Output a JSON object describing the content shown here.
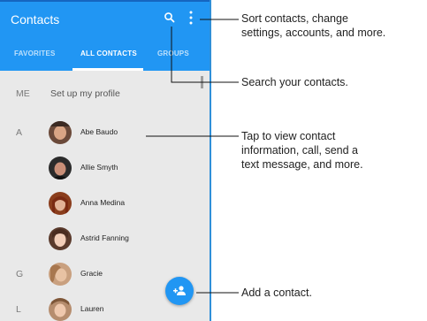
{
  "app": {
    "title": "Contacts",
    "search_icon": "search-icon",
    "more_icon": "more-vert-icon",
    "accent_color": "#2196f3"
  },
  "tabs": [
    {
      "label": "FAVORITES",
      "active": false
    },
    {
      "label": "ALL CONTACTS",
      "active": true
    },
    {
      "label": "GROUPS",
      "active": false
    }
  ],
  "profile": {
    "letter": "ME",
    "text": "Set up my profile"
  },
  "contacts": [
    {
      "letter": "A",
      "name": "Abe Baudo"
    },
    {
      "letter": "",
      "name": "Allie Smyth"
    },
    {
      "letter": "",
      "name": "Anna Medina"
    },
    {
      "letter": "",
      "name": "Astrid Fanning"
    },
    {
      "letter": "G",
      "name": "Gracie"
    },
    {
      "letter": "L",
      "name": "Lauren"
    }
  ],
  "fab": {
    "icon": "add-person-icon"
  },
  "callouts": {
    "menu": [
      "Sort contacts, change",
      "settings, accounts, and more."
    ],
    "search": [
      "Search your contacts."
    ],
    "contact": [
      "Tap to view contact",
      "information, call, send a",
      "text message, and more."
    ],
    "add": [
      "Add a contact."
    ]
  }
}
